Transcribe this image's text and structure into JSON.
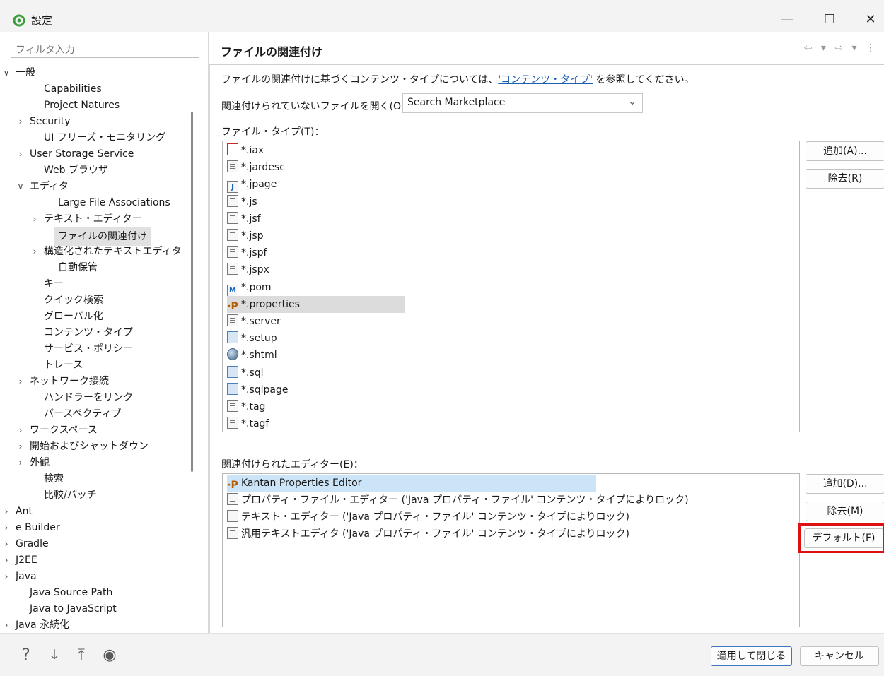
{
  "window": {
    "title": "設定",
    "minimize": "—",
    "maximize": "☐",
    "close": "✕"
  },
  "filter": {
    "placeholder": "フィルタ入力"
  },
  "tree": [
    {
      "label": "一般",
      "arrow": "∨"
    },
    {
      "label": "Capabilities",
      "arrow": ""
    },
    {
      "label": "Project Natures",
      "arrow": ""
    },
    {
      "label": "Security",
      "arrow": "›"
    },
    {
      "label": "UI フリーズ・モニタリング",
      "arrow": ""
    },
    {
      "label": "User Storage Service",
      "arrow": "›"
    },
    {
      "label": "Web ブラウザ",
      "arrow": ""
    },
    {
      "label": "エディタ",
      "arrow": "∨"
    },
    {
      "label": "Large File Associations",
      "arrow": ""
    },
    {
      "label": "テキスト・エディター",
      "arrow": "›"
    },
    {
      "label": "ファイルの関連付け",
      "arrow": ""
    },
    {
      "label": "構造化されたテキストエディタ",
      "arrow": "›"
    },
    {
      "label": "自動保管",
      "arrow": ""
    },
    {
      "label": "キー",
      "arrow": ""
    },
    {
      "label": "クイック検索",
      "arrow": ""
    },
    {
      "label": "グローバル化",
      "arrow": ""
    },
    {
      "label": "コンテンツ・タイプ",
      "arrow": ""
    },
    {
      "label": "サービス・ポリシー",
      "arrow": ""
    },
    {
      "label": "トレース",
      "arrow": ""
    },
    {
      "label": "ネットワーク接続",
      "arrow": "›"
    },
    {
      "label": "ハンドラーをリンク",
      "arrow": ""
    },
    {
      "label": "パースペクティブ",
      "arrow": ""
    },
    {
      "label": "ワークスペース",
      "arrow": "›"
    },
    {
      "label": "開始およびシャットダウン",
      "arrow": "›"
    },
    {
      "label": "外観",
      "arrow": "›"
    },
    {
      "label": "検索",
      "arrow": ""
    },
    {
      "label": "比較/パッチ",
      "arrow": ""
    },
    {
      "label": "Ant",
      "arrow": "›"
    },
    {
      "label": "e Builder",
      "arrow": "›"
    },
    {
      "label": "Gradle",
      "arrow": "›"
    },
    {
      "label": "J2EE",
      "arrow": "›"
    },
    {
      "label": "Java",
      "arrow": "›"
    },
    {
      "label": "Java Source Path",
      "arrow": ""
    },
    {
      "label": "Java to JavaScript",
      "arrow": ""
    },
    {
      "label": "Java 永続化",
      "arrow": "›"
    }
  ],
  "page": {
    "title": "ファイルの関連付け",
    "nav": "⇦ ▾ ⇨ ▾ ⋮",
    "desc_prefix": "ファイルの関連付けに基づくコンテンツ・タイプについては、",
    "desc_link": "'コンテンツ・タイプ'",
    "desc_suffix": " を参照してください。",
    "open_label": "関連付けられていないファイルを開く(O)：",
    "open_value": "Search Marketplace",
    "file_types_label": "ファイル・タイプ(T)：",
    "editors_label": "関連付けられたエディター(E)："
  },
  "file_types": [
    {
      "name": "*.iax",
      "icon": "red-icon"
    },
    {
      "name": "*.jardesc",
      "icon": "jar-icon"
    },
    {
      "name": "*.jpage",
      "icon": "java-page-icon"
    },
    {
      "name": "*.js",
      "icon": "doc-icon"
    },
    {
      "name": "*.jsf",
      "icon": "doc-icon"
    },
    {
      "name": "*.jsp",
      "icon": "doc-icon"
    },
    {
      "name": "*.jspf",
      "icon": "doc-icon"
    },
    {
      "name": "*.jspx",
      "icon": "doc-icon"
    },
    {
      "name": "*.pom",
      "icon": "maven-icon"
    },
    {
      "name": "*.properties",
      "icon": "properties-icon"
    },
    {
      "name": "*.server",
      "icon": "server-icon"
    },
    {
      "name": "*.setup",
      "icon": "setup-icon"
    },
    {
      "name": "*.shtml",
      "icon": "globe-icon"
    },
    {
      "name": "*.sql",
      "icon": "sql-icon"
    },
    {
      "name": "*.sqlpage",
      "icon": "sql-icon"
    },
    {
      "name": "*.tag",
      "icon": "doc-icon"
    },
    {
      "name": "*.tagf",
      "icon": "doc-icon"
    }
  ],
  "editors": [
    {
      "name": "Kantan Properties Editor",
      "icon": "properties-icon"
    },
    {
      "name": "プロパティ・ファイル・エディター ('Java プロパティ・ファイル' コンテンツ・タイプによりロック)",
      "icon": "doc-icon"
    },
    {
      "name": "テキスト・エディター ('Java プロパティ・ファイル' コンテンツ・タイプによりロック)",
      "icon": "doc-icon"
    },
    {
      "name": "汎用テキストエディタ ('Java プロパティ・ファイル' コンテンツ・タイプによりロック)",
      "icon": "generic-editor-icon"
    }
  ],
  "buttons": {
    "add_filetype": "追加(A)...",
    "remove_filetype": "除去(R)",
    "add_editor": "追加(D)...",
    "remove_editor": "除去(M)",
    "default": "デフォルト(F)",
    "apply_close": "適用して閉じる",
    "cancel": "キャンセル"
  },
  "bottom_icons": [
    "help-icon",
    "import-icon",
    "export-icon",
    "record-icon"
  ],
  "colors": {
    "highlight": "#dd1111",
    "selection": "#cce4f7",
    "link": "#1a5fb4"
  }
}
